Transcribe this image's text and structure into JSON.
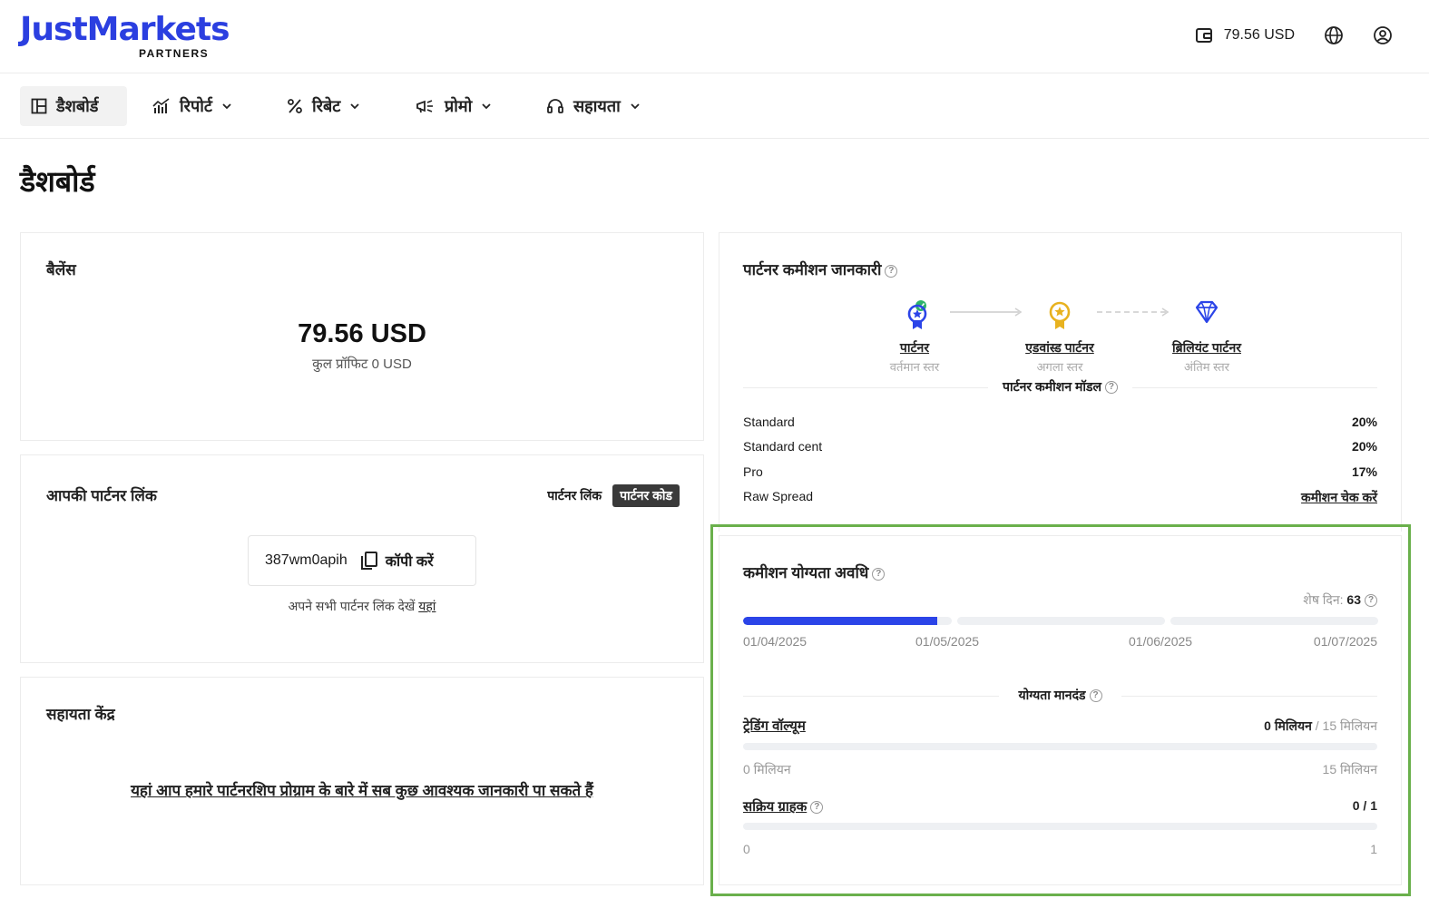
{
  "header": {
    "logo_main": "JustMarkets",
    "logo_sub": "PARTNERS",
    "balance": "79.56 USD",
    "icons": [
      "wallet-icon",
      "globe-icon",
      "user-icon"
    ]
  },
  "nav": {
    "items": [
      {
        "label": "डैशबोर्ड",
        "icon": "dashboard-icon"
      },
      {
        "label": "रिपोर्ट",
        "icon": "chart-icon"
      },
      {
        "label": "रिबेट",
        "icon": "percent-icon"
      },
      {
        "label": "प्रोमो",
        "icon": "megaphone-icon"
      },
      {
        "label": "सहायता",
        "icon": "headset-icon"
      }
    ]
  },
  "page": {
    "title": "डैशबोर्ड"
  },
  "balance_card": {
    "title": "बैलेंस",
    "amount": "79.56 USD",
    "sub": "कुल प्रॉफिट 0 USD"
  },
  "link_card": {
    "title": "आपकी पार्टनर लिंक",
    "toggle_link": "पार्टनर लिंक",
    "toggle_code": "पार्टनर कोड",
    "code": "387wm0apih",
    "copy_label": "कॉपी करें",
    "note": "अपने सभी पार्टनर लिंक देखें",
    "note_link": "यहां"
  },
  "help_card": {
    "title": "सहायता केंद्र",
    "text": "यहां आप हमारे पार्टनरशिप प्रोग्राम के बारे में सब कुछ आवश्यक जानकारी पा सकते हैं"
  },
  "commission_card": {
    "title": "पार्टनर कमीशन जानकारी",
    "levels": [
      {
        "name": "पार्टनर",
        "sub": "वर्तमान स्तर"
      },
      {
        "name": "एडवांस्ड पार्टनर",
        "sub": "अगला स्तर"
      },
      {
        "name": "ब्रिलियंट पार्टनर",
        "sub": "अंतिम स्तर"
      }
    ],
    "model_title": "पार्टनर कमीशन मॉडल",
    "rows": [
      {
        "name": "Standard",
        "value": "20%"
      },
      {
        "name": "Standard cent",
        "value": "20%"
      },
      {
        "name": "Pro",
        "value": "17%"
      },
      {
        "name": "Raw Spread",
        "value": "कमीशन चेक करें"
      }
    ],
    "colors": {
      "gold": "#e8b21f",
      "blue": "#2b44e8",
      "check": "#2db36b"
    }
  },
  "eligibility_card": {
    "title": "कमीशन योग्यता अवधि",
    "remaining_label": "शेष दिन:",
    "remaining_value": "63",
    "period_progress": 0.93,
    "dates": [
      "01/04/2025",
      "01/05/2025",
      "01/06/2025",
      "01/07/2025"
    ],
    "criteria_title": "योग्यता मानदंड",
    "volume": {
      "label": "ट्रेडिंग वॉल्यूम",
      "current": "0 मिलियन",
      "target": "/ 15 मिलियन",
      "min": "0 मिलियन",
      "max": "15 मिलियन",
      "progress": 0
    },
    "clients": {
      "label": "सक्रिय ग्राहक",
      "value": "0 / 1",
      "min": "0",
      "max": "1",
      "progress": 0
    }
  }
}
